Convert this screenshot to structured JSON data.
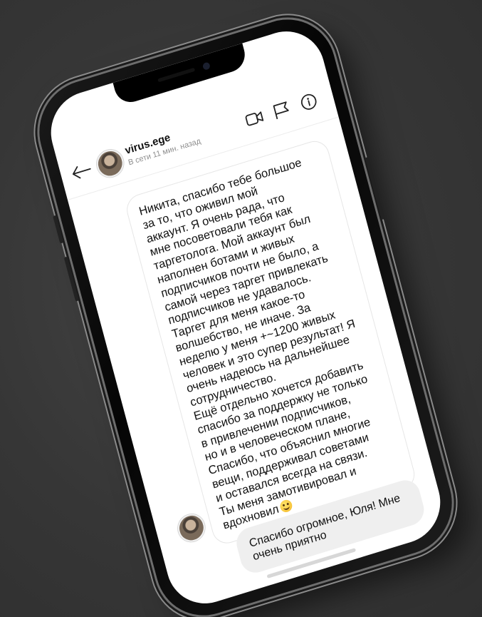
{
  "chat_header": {
    "username": "virus.ege",
    "status": "В сети 11 мин. назад",
    "icons": [
      "back-arrow-icon",
      "video-call-icon",
      "flag-icon",
      "info-icon"
    ]
  },
  "messages": {
    "incoming": {
      "text": "Никита, спасибо тебе большое\nза то, что оживил мой\nаккаунт. Я очень рада, что\nмне посоветовали тебя как\nтаргетолога. Мой аккаунт был\nнаполнен ботами и живых\nподписчиков почти не было, а\nсамой через таргет привлекать\nподписчиков не удавалось.\nТаргет для меня какое-то\nволшебство, не иначе. За\nнеделю у меня +~1200 живых\nчеловек и это супер результат! Я\nочень надеюсь на дальнейшее\nсотрудничество.\nЕщё отдельно хочется добавить\nспасибо за поддержку не только\nв привлечении подписчиков,\nно и в человеческом плане,\nСпасибо, что объяснил многие\nвещи, поддерживал советами\nи оставался всегда на связи.\nТы меня замотивировал и\nвдохновил",
      "emoji": "smiling-face-icon"
    },
    "outgoing": {
      "text": "Спасибо огромное, Юля! Мне очень приятно"
    }
  },
  "colors": {
    "background": "#3a3a3a",
    "screen": "#ffffff",
    "outgoing_bubble": "#efefef",
    "status_text": "#8e8e8e"
  }
}
